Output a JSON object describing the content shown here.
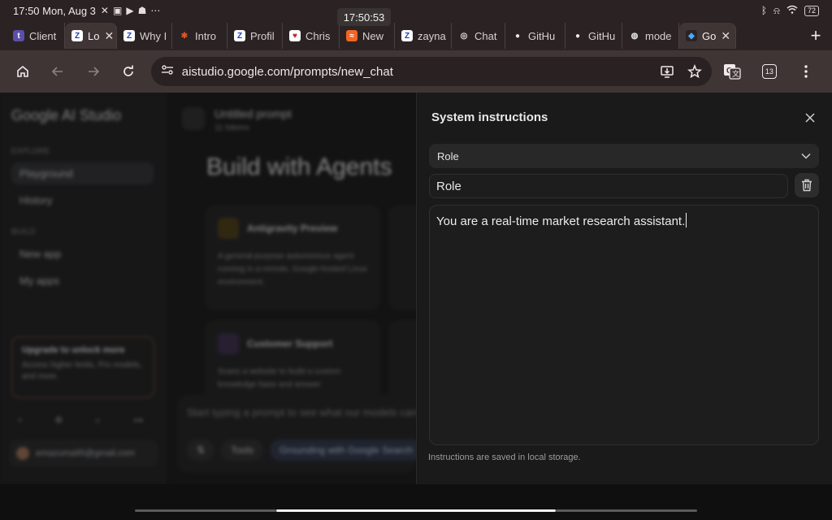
{
  "status": {
    "time_date": "17:50 Mon, Aug 3",
    "battery": "72",
    "clock_tooltip": "17:50:53",
    "left_icons": [
      "status-x-icon",
      "status-ok-icon",
      "status-play-icon",
      "status-snap-icon",
      "status-more-icon"
    ],
    "right_icons": [
      "bluetooth-icon",
      "silent-icon",
      "wifi-icon"
    ]
  },
  "tabs": [
    {
      "label": "Client",
      "fav": "t",
      "fav_color": "#5b4fa8",
      "fav_text": "#ffffff"
    },
    {
      "label": "Lo",
      "fav": "Z",
      "fav_color": "#ffffff",
      "fav_text": "#1e40af",
      "active": true
    },
    {
      "label": "Why I",
      "fav": "Z",
      "fav_color": "#ffffff",
      "fav_text": "#1e40af"
    },
    {
      "label": "Intro",
      "fav": "✱",
      "fav_color": "#2b2323",
      "fav_text": "#d9572b"
    },
    {
      "label": "Profil",
      "fav": "Z",
      "fav_color": "#ffffff",
      "fav_text": "#1e40af"
    },
    {
      "label": "Chris",
      "fav": "♥",
      "fav_color": "#ffffff",
      "fav_text": "#c0263a"
    },
    {
      "label": "New",
      "fav": "≈",
      "fav_color": "#f26522",
      "fav_text": "#ffffff"
    },
    {
      "label": "zayna",
      "fav": "Z",
      "fav_color": "#ffffff",
      "fav_text": "#1e40af"
    },
    {
      "label": "Chat",
      "fav": "◎",
      "fav_color": "#2b2323",
      "fav_text": "#e8e8e8"
    },
    {
      "label": "GitHu",
      "fav": "●",
      "fav_color": "#2b2323",
      "fav_text": "#e8e8e8"
    },
    {
      "label": "GitHu",
      "fav": "●",
      "fav_color": "#2b2323",
      "fav_text": "#e8e8e8"
    },
    {
      "label": "mode",
      "fav": "◍",
      "fav_color": "#2b2323",
      "fav_text": "#e8e8e8"
    },
    {
      "label": "Go",
      "fav": "◆",
      "fav_color": "#2b2323",
      "fav_text": "#4aa8ff",
      "active2": true
    }
  ],
  "toolbar": {
    "url": "aistudio.google.com/prompts/new_chat",
    "tab_count": "13"
  },
  "bg": {
    "brand": "Google AI Studio",
    "explore": "EXPLORE",
    "playground": "Playground",
    "history": "History",
    "build": "BUILD",
    "new_app": "New app",
    "my_apps": "My apps",
    "upgrade_title": "Upgrade to unlock more",
    "upgrade_desc": "Access higher limits, Pro models, and more.",
    "account": "emazuma95@gmail.com",
    "prompt_title": "Untitled prompt",
    "tokens": "11 tokens",
    "hero": "Build with Agents",
    "card1_title": "Antigravity Preview",
    "card1_desc": "A general-purpose autonomous agent running in a remote, Google-hosted Linux environment.",
    "card2_title": "Customer Support",
    "card2_desc": "Scans a website to build a custom knowledge base and answer",
    "placeholder": "Start typing a prompt to see what our models can do",
    "chip_tools": "Tools",
    "chip_grounding": "Grounding with Google Search"
  },
  "panel": {
    "title": "System instructions",
    "select_value": "Role",
    "role_value": "Role",
    "instructions": "You are a real-time market research assistant.",
    "footer": "Instructions are saved in local storage."
  }
}
